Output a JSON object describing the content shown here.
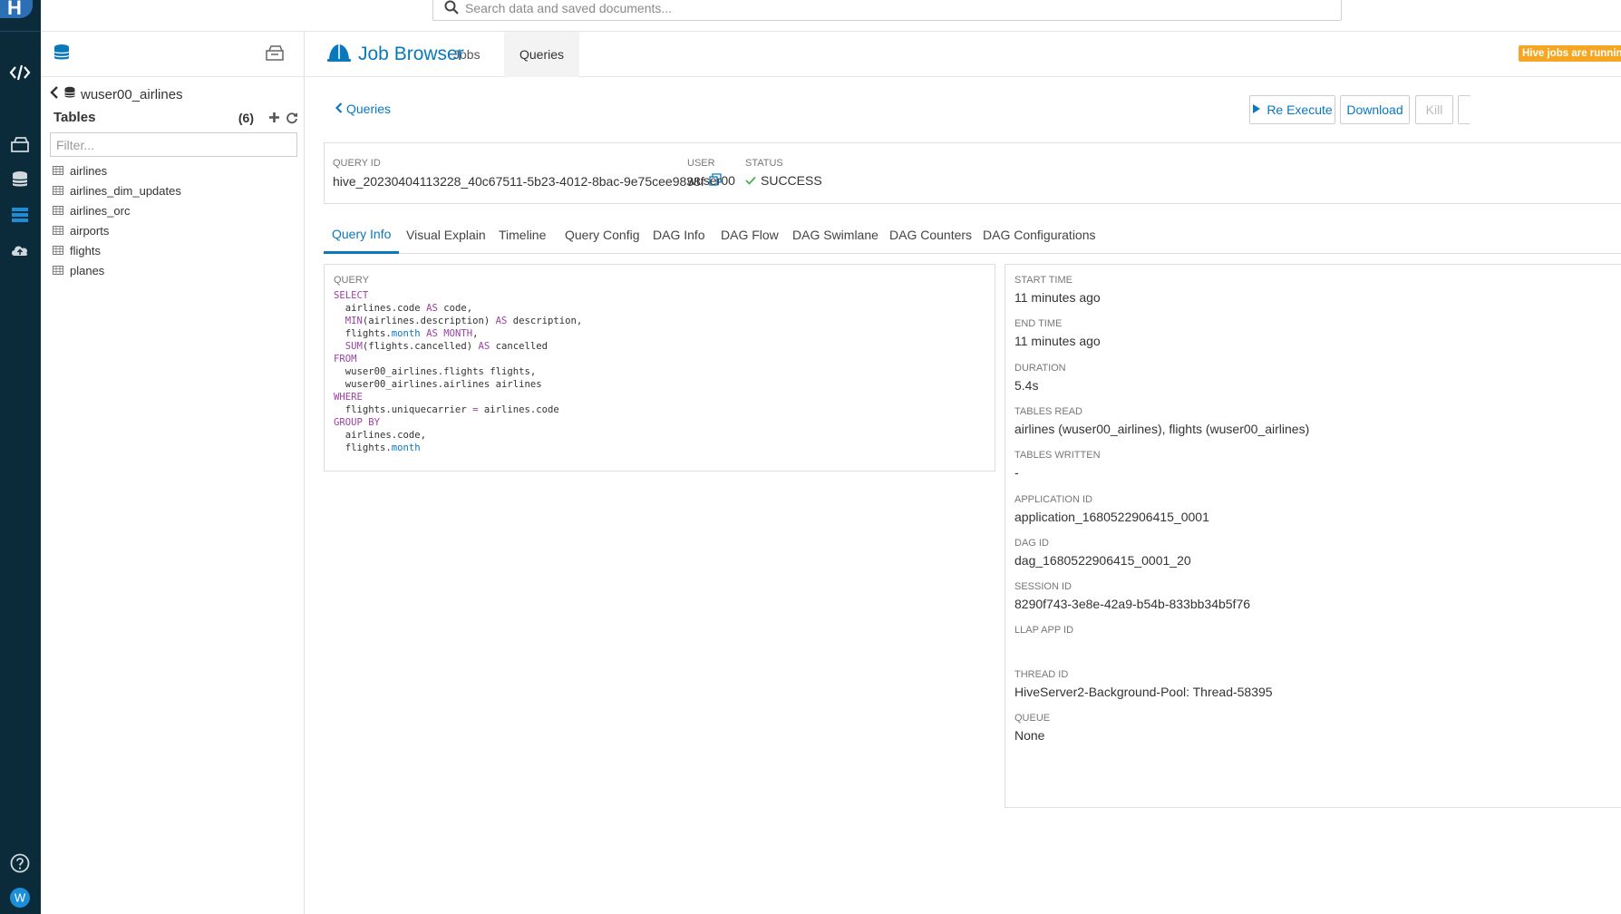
{
  "search": {
    "placeholder": "Search data and saved documents..."
  },
  "left_panel": {
    "database": "wuser00_airlines",
    "tables_label": "Tables",
    "tables_count": "(6)",
    "filter_placeholder": "Filter...",
    "tables": [
      "airlines",
      "airlines_dim_updates",
      "airlines_orc",
      "airports",
      "flights",
      "planes"
    ]
  },
  "header": {
    "app_title": "Job Browser",
    "nav": [
      "Jobs",
      "Queries"
    ],
    "running_badge": "Hive jobs are running"
  },
  "toolbar": {
    "back": "Queries",
    "re_execute": "Re Execute",
    "download": "Download",
    "kill": "Kill"
  },
  "query_meta": {
    "query_id_label": "QUERY ID",
    "query_id": "hive_20230404113228_40c67511-5b23-4012-8bac-9e75cee9838f",
    "user_label": "USER",
    "user": "wuser00",
    "status_label": "STATUS",
    "status": "SUCCESS"
  },
  "tabs": [
    "Query Info",
    "Visual Explain",
    "Timeline",
    "Query Config",
    "DAG Info",
    "DAG Flow",
    "DAG Swimlane",
    "DAG Counters",
    "DAG Configurations"
  ],
  "query": {
    "label": "QUERY",
    "lines": [
      "SELECT",
      "  airlines.code AS code,",
      "  MIN(airlines.description) AS description,",
      "  flights.month AS MONTH,",
      "  SUM(flights.cancelled) AS cancelled",
      "FROM",
      "  wuser00_airlines.flights flights,",
      "  wuser00_airlines.airlines airlines",
      "WHERE",
      "  flights.uniquecarrier = airlines.code",
      "GROUP BY",
      "  airlines.code,",
      "  flights.month"
    ]
  },
  "info": [
    {
      "label": "START TIME",
      "value": "11 minutes ago"
    },
    {
      "label": "END TIME",
      "value": "11 minutes ago"
    },
    {
      "label": "DURATION",
      "value": "5.4s"
    },
    {
      "label": "TABLES READ",
      "value": "airlines (wuser00_airlines), flights (wuser00_airlines)"
    },
    {
      "label": "TABLES WRITTEN",
      "value": "-"
    },
    {
      "label": "APPLICATION ID",
      "value": "application_1680522906415_0001"
    },
    {
      "label": "DAG ID",
      "value": "dag_1680522906415_0001_20"
    },
    {
      "label": "SESSION ID",
      "value": "8290f743-3e8e-42a9-b54b-833bb34b5f76"
    },
    {
      "label": "LLAP APP ID",
      "value": ""
    },
    {
      "label": "THREAD ID",
      "value": "HiveServer2-Background-Pool: Thread-58395"
    },
    {
      "label": "QUEUE",
      "value": "None"
    }
  ],
  "colors": {
    "accent": "#0a78bd",
    "rail": "#0b2b3b",
    "badge": "#f5a623",
    "success": "#4caf50"
  },
  "icons": [
    "hue-logo",
    "editor-icon",
    "documents-icon",
    "database-icon",
    "jobs-icon",
    "cloud-icon",
    "help-icon",
    "user-avatar-icon",
    "search-icon",
    "database-icon",
    "box-icon",
    "chevron-left-icon",
    "plus-icon",
    "refresh-icon",
    "table-icon",
    "job-browser-logo-icon",
    "play-icon",
    "copy-icon",
    "check-icon"
  ]
}
